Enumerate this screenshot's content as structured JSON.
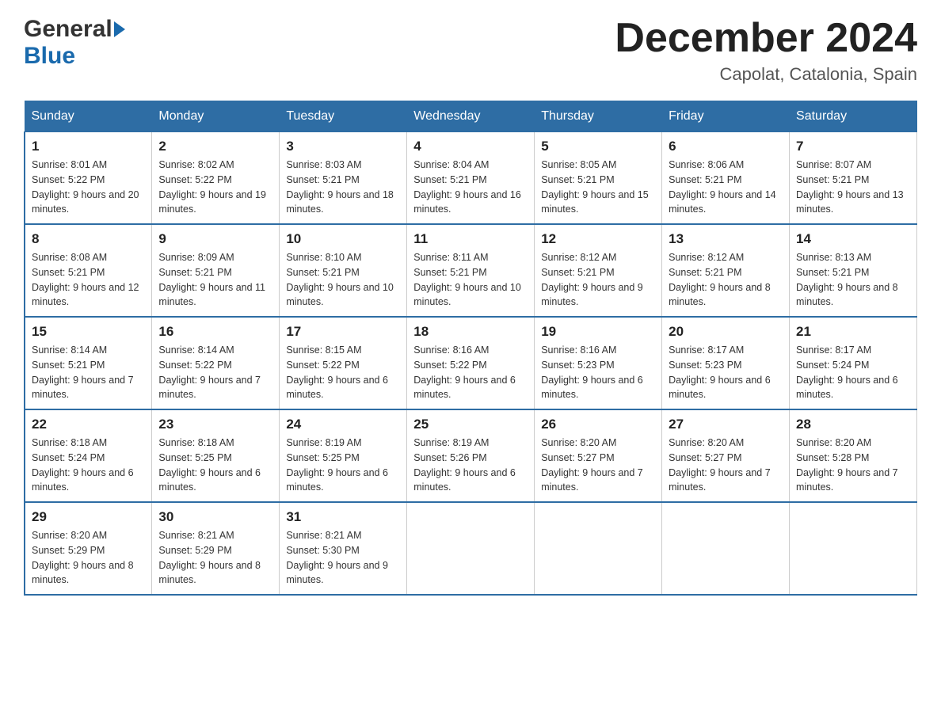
{
  "header": {
    "month_year": "December 2024",
    "location": "Capolat, Catalonia, Spain",
    "logo_general": "General",
    "logo_blue": "Blue"
  },
  "columns": [
    "Sunday",
    "Monday",
    "Tuesday",
    "Wednesday",
    "Thursday",
    "Friday",
    "Saturday"
  ],
  "weeks": [
    [
      {
        "day": "1",
        "sunrise": "Sunrise: 8:01 AM",
        "sunset": "Sunset: 5:22 PM",
        "daylight": "Daylight: 9 hours and 20 minutes."
      },
      {
        "day": "2",
        "sunrise": "Sunrise: 8:02 AM",
        "sunset": "Sunset: 5:22 PM",
        "daylight": "Daylight: 9 hours and 19 minutes."
      },
      {
        "day": "3",
        "sunrise": "Sunrise: 8:03 AM",
        "sunset": "Sunset: 5:21 PM",
        "daylight": "Daylight: 9 hours and 18 minutes."
      },
      {
        "day": "4",
        "sunrise": "Sunrise: 8:04 AM",
        "sunset": "Sunset: 5:21 PM",
        "daylight": "Daylight: 9 hours and 16 minutes."
      },
      {
        "day": "5",
        "sunrise": "Sunrise: 8:05 AM",
        "sunset": "Sunset: 5:21 PM",
        "daylight": "Daylight: 9 hours and 15 minutes."
      },
      {
        "day": "6",
        "sunrise": "Sunrise: 8:06 AM",
        "sunset": "Sunset: 5:21 PM",
        "daylight": "Daylight: 9 hours and 14 minutes."
      },
      {
        "day": "7",
        "sunrise": "Sunrise: 8:07 AM",
        "sunset": "Sunset: 5:21 PM",
        "daylight": "Daylight: 9 hours and 13 minutes."
      }
    ],
    [
      {
        "day": "8",
        "sunrise": "Sunrise: 8:08 AM",
        "sunset": "Sunset: 5:21 PM",
        "daylight": "Daylight: 9 hours and 12 minutes."
      },
      {
        "day": "9",
        "sunrise": "Sunrise: 8:09 AM",
        "sunset": "Sunset: 5:21 PM",
        "daylight": "Daylight: 9 hours and 11 minutes."
      },
      {
        "day": "10",
        "sunrise": "Sunrise: 8:10 AM",
        "sunset": "Sunset: 5:21 PM",
        "daylight": "Daylight: 9 hours and 10 minutes."
      },
      {
        "day": "11",
        "sunrise": "Sunrise: 8:11 AM",
        "sunset": "Sunset: 5:21 PM",
        "daylight": "Daylight: 9 hours and 10 minutes."
      },
      {
        "day": "12",
        "sunrise": "Sunrise: 8:12 AM",
        "sunset": "Sunset: 5:21 PM",
        "daylight": "Daylight: 9 hours and 9 minutes."
      },
      {
        "day": "13",
        "sunrise": "Sunrise: 8:12 AM",
        "sunset": "Sunset: 5:21 PM",
        "daylight": "Daylight: 9 hours and 8 minutes."
      },
      {
        "day": "14",
        "sunrise": "Sunrise: 8:13 AM",
        "sunset": "Sunset: 5:21 PM",
        "daylight": "Daylight: 9 hours and 8 minutes."
      }
    ],
    [
      {
        "day": "15",
        "sunrise": "Sunrise: 8:14 AM",
        "sunset": "Sunset: 5:21 PM",
        "daylight": "Daylight: 9 hours and 7 minutes."
      },
      {
        "day": "16",
        "sunrise": "Sunrise: 8:14 AM",
        "sunset": "Sunset: 5:22 PM",
        "daylight": "Daylight: 9 hours and 7 minutes."
      },
      {
        "day": "17",
        "sunrise": "Sunrise: 8:15 AM",
        "sunset": "Sunset: 5:22 PM",
        "daylight": "Daylight: 9 hours and 6 minutes."
      },
      {
        "day": "18",
        "sunrise": "Sunrise: 8:16 AM",
        "sunset": "Sunset: 5:22 PM",
        "daylight": "Daylight: 9 hours and 6 minutes."
      },
      {
        "day": "19",
        "sunrise": "Sunrise: 8:16 AM",
        "sunset": "Sunset: 5:23 PM",
        "daylight": "Daylight: 9 hours and 6 minutes."
      },
      {
        "day": "20",
        "sunrise": "Sunrise: 8:17 AM",
        "sunset": "Sunset: 5:23 PM",
        "daylight": "Daylight: 9 hours and 6 minutes."
      },
      {
        "day": "21",
        "sunrise": "Sunrise: 8:17 AM",
        "sunset": "Sunset: 5:24 PM",
        "daylight": "Daylight: 9 hours and 6 minutes."
      }
    ],
    [
      {
        "day": "22",
        "sunrise": "Sunrise: 8:18 AM",
        "sunset": "Sunset: 5:24 PM",
        "daylight": "Daylight: 9 hours and 6 minutes."
      },
      {
        "day": "23",
        "sunrise": "Sunrise: 8:18 AM",
        "sunset": "Sunset: 5:25 PM",
        "daylight": "Daylight: 9 hours and 6 minutes."
      },
      {
        "day": "24",
        "sunrise": "Sunrise: 8:19 AM",
        "sunset": "Sunset: 5:25 PM",
        "daylight": "Daylight: 9 hours and 6 minutes."
      },
      {
        "day": "25",
        "sunrise": "Sunrise: 8:19 AM",
        "sunset": "Sunset: 5:26 PM",
        "daylight": "Daylight: 9 hours and 6 minutes."
      },
      {
        "day": "26",
        "sunrise": "Sunrise: 8:20 AM",
        "sunset": "Sunset: 5:27 PM",
        "daylight": "Daylight: 9 hours and 7 minutes."
      },
      {
        "day": "27",
        "sunrise": "Sunrise: 8:20 AM",
        "sunset": "Sunset: 5:27 PM",
        "daylight": "Daylight: 9 hours and 7 minutes."
      },
      {
        "day": "28",
        "sunrise": "Sunrise: 8:20 AM",
        "sunset": "Sunset: 5:28 PM",
        "daylight": "Daylight: 9 hours and 7 minutes."
      }
    ],
    [
      {
        "day": "29",
        "sunrise": "Sunrise: 8:20 AM",
        "sunset": "Sunset: 5:29 PM",
        "daylight": "Daylight: 9 hours and 8 minutes."
      },
      {
        "day": "30",
        "sunrise": "Sunrise: 8:21 AM",
        "sunset": "Sunset: 5:29 PM",
        "daylight": "Daylight: 9 hours and 8 minutes."
      },
      {
        "day": "31",
        "sunrise": "Sunrise: 8:21 AM",
        "sunset": "Sunset: 5:30 PM",
        "daylight": "Daylight: 9 hours and 9 minutes."
      },
      null,
      null,
      null,
      null
    ]
  ]
}
